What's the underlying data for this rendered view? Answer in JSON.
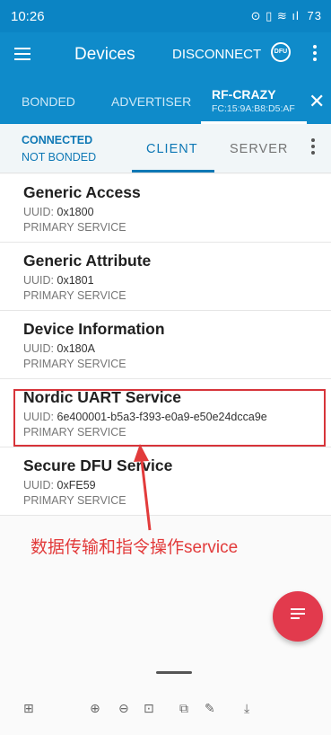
{
  "status_bar": {
    "time": "10:26",
    "right_glyphs": "⊙ ▯ ≋ ıl",
    "battery": "73"
  },
  "app_bar": {
    "title": "Devices",
    "disconnect_label": "DISCONNECT",
    "dfu_label": "DFU"
  },
  "tabs": {
    "bonded": "BONDED",
    "advertiser": "ADVERTISER",
    "device_name": "RF-CRAZY",
    "device_mac": "FC:15:9A:B8:D5:AF",
    "close_glyph": "✕"
  },
  "sub_bar": {
    "connection": "CONNECTED",
    "bond_state": "NOT BONDED",
    "client_tab": "CLIENT",
    "server_tab": "SERVER"
  },
  "services": [
    {
      "name": "Generic Access",
      "uuid_label": "UUID:",
      "uuid": "0x1800",
      "type": "PRIMARY SERVICE"
    },
    {
      "name": "Generic Attribute",
      "uuid_label": "UUID:",
      "uuid": "0x1801",
      "type": "PRIMARY SERVICE"
    },
    {
      "name": "Device Information",
      "uuid_label": "UUID:",
      "uuid": "0x180A",
      "type": "PRIMARY SERVICE"
    },
    {
      "name": "Nordic UART Service",
      "uuid_label": "UUID:",
      "uuid": "6e400001-b5a3-f393-e0a9-e50e24dcca9e",
      "type": "PRIMARY SERVICE"
    },
    {
      "name": "Secure DFU Service",
      "uuid_label": "UUID:",
      "uuid": "0xFE59",
      "type": "PRIMARY SERVICE"
    }
  ],
  "annotation": "数据传输和指令操作service",
  "bottom_toolbar": [
    "⊞",
    "⊕",
    "⊖",
    "⊡",
    "⧉",
    "✎",
    "⤓"
  ],
  "colors": {
    "primary": "#0f8bca",
    "accent": "#e23a4d",
    "annotation": "#e23b3b"
  }
}
